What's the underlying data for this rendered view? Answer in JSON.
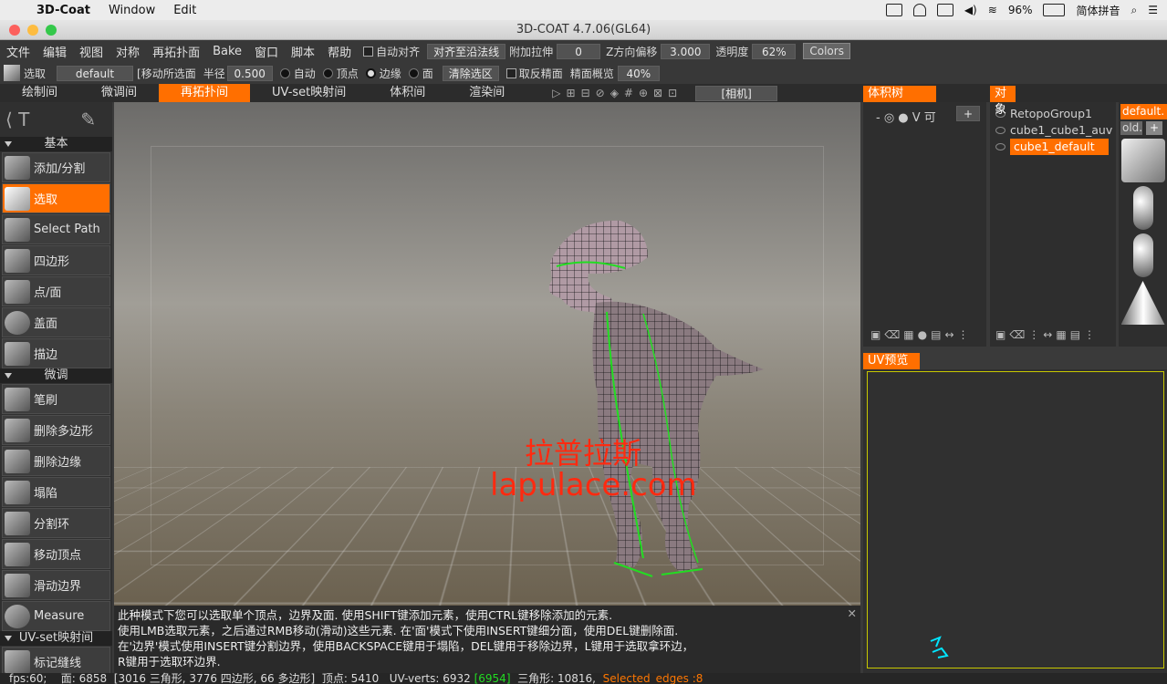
{
  "mac_menu": {
    "app": "3D-Coat",
    "items": [
      "Window",
      "Edit"
    ],
    "battery": "96%",
    "input_method": "简体拼音"
  },
  "window_title": "3D-COAT 4.7.06(GL64)",
  "menu": [
    "文件",
    "编辑",
    "视图",
    "对称",
    "再拓扑面",
    "Bake",
    "窗口",
    "脚本",
    "帮助"
  ],
  "toolbar1": {
    "auto_snap": "自动对齐",
    "snap_to_normal": "对齐至沿法线",
    "extra_extrude_label": "附加拉伸",
    "extra_extrude": "0",
    "z_offset_label": "Z方向偏移",
    "z_offset": "3.000",
    "opacity_label": "透明度",
    "opacity": "62%",
    "colors_button": "Colors"
  },
  "toolbar2": {
    "tool_name": "选取",
    "preset": "default",
    "mode": "[移动所选面",
    "radius_label": "半径",
    "radius": "0.500",
    "auto": "自动",
    "vertex": "顶点",
    "edge": "边缘",
    "face": "面",
    "clear_selection": "清除选区",
    "invert_faces": "取反精面",
    "face_transparency_label": "精面概览",
    "face_transparency": "40%"
  },
  "room_tabs": [
    "绘制间",
    "微调间",
    "再拓扑间",
    "UV-set映射间",
    "体积间",
    "渲染间"
  ],
  "active_room": "再拓扑间",
  "camera_label": "[相机]",
  "palette": {
    "sections": [
      {
        "title": "基本",
        "tools": [
          "添加/分割",
          "选取",
          "Select Path",
          "四边形",
          "点/面",
          "盖面",
          "描边"
        ]
      },
      {
        "title": "微调",
        "tools": [
          "笔刷",
          "删除多边形",
          "删除边缘",
          "塌陷",
          "分割环",
          "移动顶点",
          "滑动边界",
          "Measure"
        ]
      },
      {
        "title": "UV-set映射间",
        "tools": [
          "标记缝线"
        ]
      }
    ],
    "active_tool": "选取"
  },
  "viewport": {
    "watermark_cn": "拉普拉斯",
    "watermark_url": "lapulace.com"
  },
  "help_lines": [
    "此种模式下您可以选取单个顶点，边界及面. 使用SHIFT键添加元素，使用CTRL键移除添加的元素.",
    "使用LMB选取元素，之后通过RMB移动(滑动)这些元素. 在'面'模式下使用INSERT键细分面，使用DEL键删除面.",
    "在'边界'模式使用INSERT键分割边界，使用BACKSPACE键用于塌陷，DEL键用于移除边界，L键用于选取拿环边，",
    "R键用于选取环边界."
  ],
  "status": {
    "fps": "fps:60;",
    "faces": "面: 6858",
    "tri": "[3016 三角形, 3776 四边形, 66 多边形]",
    "verts": "顶点: 5410",
    "uv_verts": "UV-verts: 6932",
    "uv_verts_alt": "[6954]",
    "triangles": "三角形: 10816,",
    "selected": "Selected_edges :8"
  },
  "panels": {
    "volume_tree": {
      "title": "体积树",
      "header_icons": "V 可"
    },
    "layers": {
      "title": "对象",
      "items": [
        "RetopoGroup1",
        "cube1_cube1_auv",
        "cube1_default"
      ],
      "active": "cube1_default"
    },
    "materials": {
      "active": "default.",
      "next": "old."
    },
    "uv_preview": {
      "title": "UV预览"
    }
  },
  "colors": {
    "accent": "#ff6f00",
    "bg": "#383838",
    "watermark": "#ff2a10",
    "highlight": "#22dd22"
  }
}
